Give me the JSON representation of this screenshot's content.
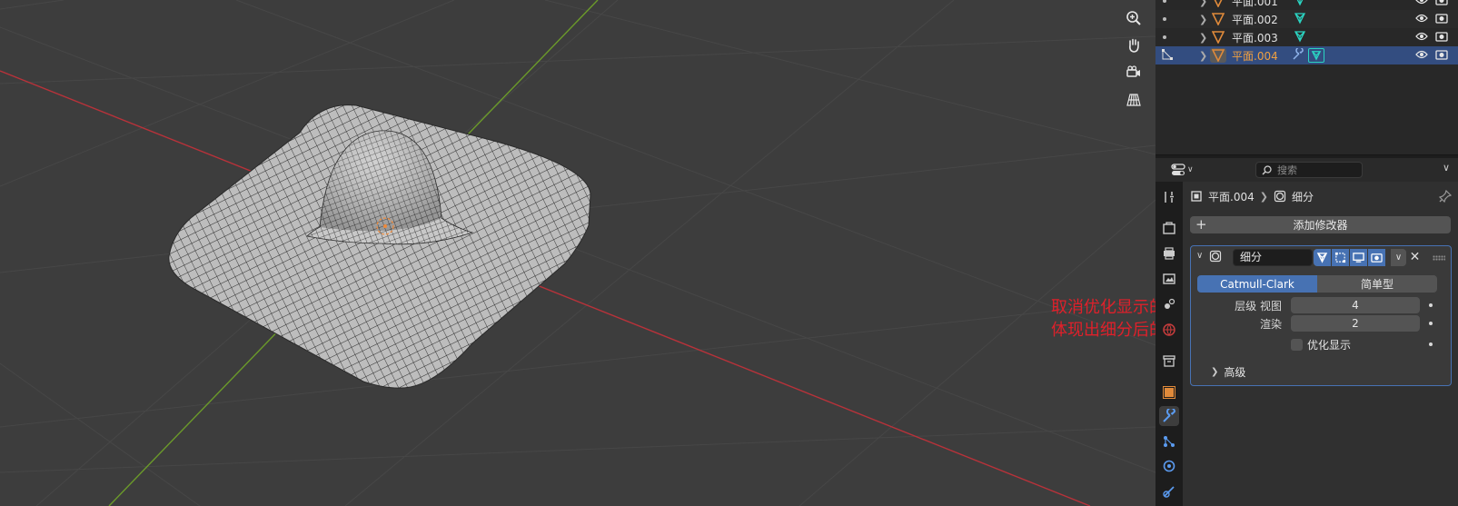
{
  "outliner": {
    "rows": [
      {
        "name": "平面.001",
        "selected": false
      },
      {
        "name": "平面.002",
        "selected": false
      },
      {
        "name": "平面.003",
        "selected": false
      },
      {
        "name": "平面.004",
        "selected": true
      }
    ]
  },
  "properties": {
    "search_placeholder": "搜索",
    "breadcrumb": {
      "object": "平面.004",
      "modifier": "细分"
    },
    "add_modifier_label": "添加修改器",
    "modifier": {
      "name": "细分",
      "mode_catmull": "Catmull-Clark",
      "mode_simple": "简单型",
      "levels_label": "层级 视图",
      "levels_value": "4",
      "render_label": "渲染",
      "render_value": "2",
      "optimal_display_label": "优化显示",
      "optimal_display_checked": false,
      "advanced_label": "高级"
    }
  },
  "annotation": {
    "text": "取消优化显示的勾选，可以体现出细分后的网格",
    "color": "#e0202a"
  },
  "colors": {
    "accent": "#4772b3",
    "selected_name": "#f0a040",
    "x_axis": "#b8323a",
    "y_axis": "#6b9a2a",
    "mesh_icon": "#2bd4c2"
  }
}
